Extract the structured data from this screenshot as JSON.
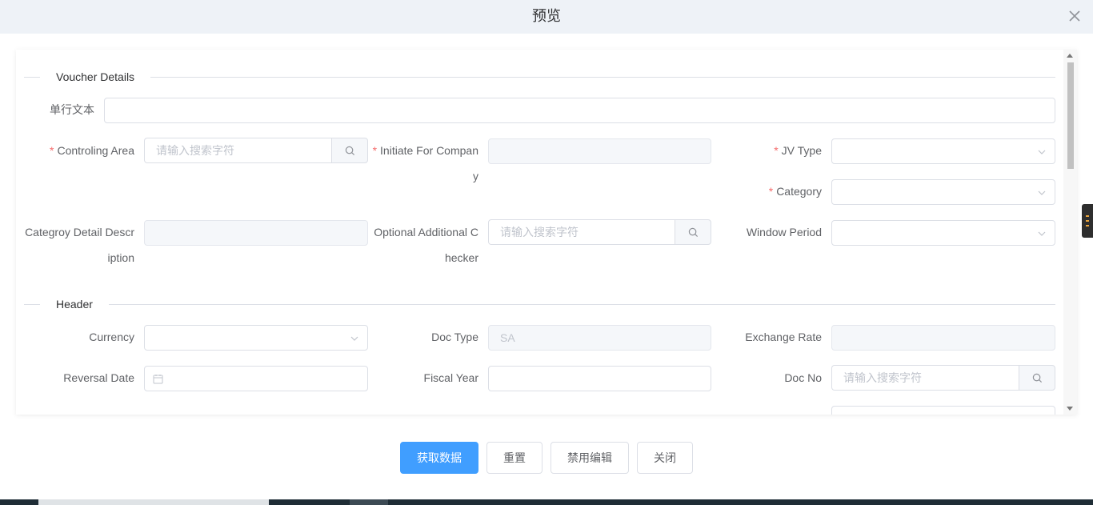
{
  "dialog": {
    "title": "预览"
  },
  "sections": {
    "voucher": {
      "title": "Voucher Details"
    },
    "header": {
      "title": "Header"
    }
  },
  "fields": {
    "single_text": {
      "label": "单行文本",
      "value": ""
    },
    "controling_area": {
      "label": "Controling Area",
      "placeholder": "请输入搜索字符",
      "required": true
    },
    "initiate_company": {
      "label": "Initiate For Company",
      "value": "",
      "required": true
    },
    "jv_type": {
      "label": "JV Type",
      "value": "",
      "required": true
    },
    "category": {
      "label": "Category",
      "value": "",
      "required": true
    },
    "category_detail": {
      "label": "Categroy Detail Description",
      "value": ""
    },
    "optional_checker": {
      "label": "Optional Additional Checker",
      "placeholder": "请输入搜索字符"
    },
    "window_period": {
      "label": "Window Period",
      "value": ""
    },
    "currency": {
      "label": "Currency",
      "value": ""
    },
    "doc_type": {
      "label": "Doc Type",
      "value": "SA"
    },
    "exchange_rate": {
      "label": "Exchange Rate",
      "value": ""
    },
    "reversal_date": {
      "label": "Reversal Date",
      "value": ""
    },
    "fiscal_year": {
      "label": "Fiscal Year",
      "value": ""
    },
    "doc_no": {
      "label": "Doc No",
      "placeholder": "请输入搜索字符"
    }
  },
  "buttons": {
    "fetch": "获取数据",
    "reset": "重置",
    "disable_edit": "禁用编辑",
    "close": "关闭"
  },
  "colors": {
    "primary": "#409eff",
    "required": "#f56c6c",
    "header_bg": "#eef2f7"
  }
}
